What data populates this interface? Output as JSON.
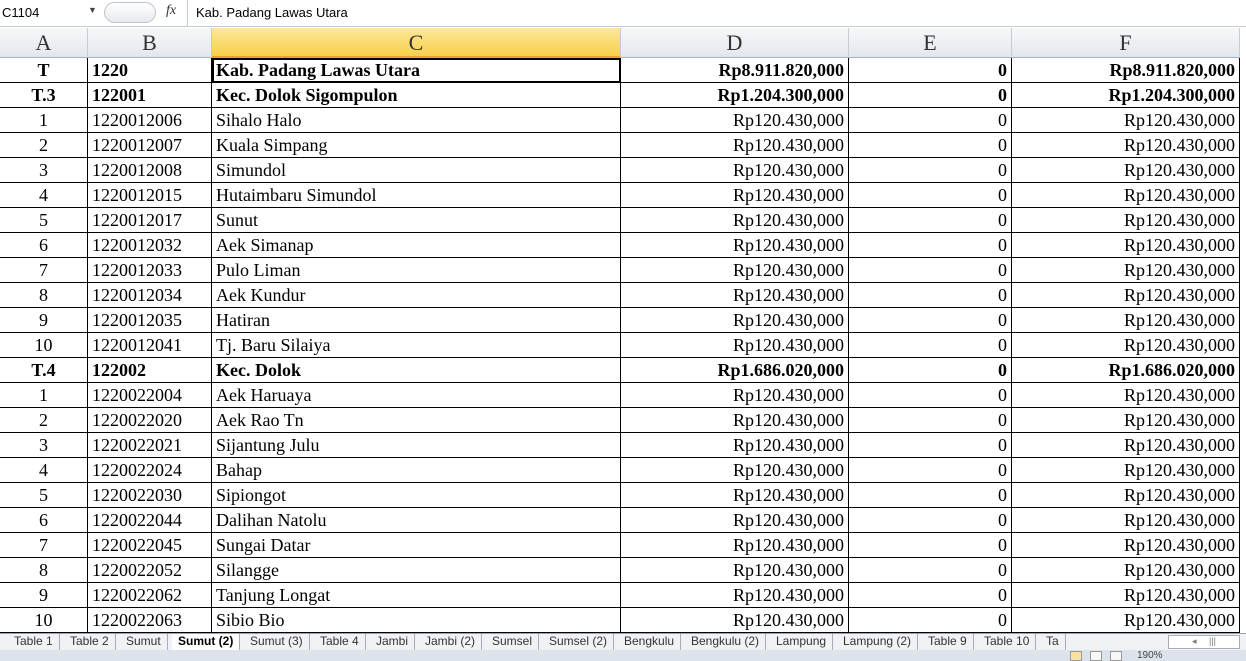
{
  "formula_bar": {
    "name_box": "C1104",
    "fx_label": "fx",
    "content": "Kab.  Padang  Lawas  Utara"
  },
  "columns": [
    "A",
    "B",
    "C",
    "D",
    "E",
    "F"
  ],
  "selected_column": "C",
  "rows": [
    {
      "a": "T",
      "b": "1220",
      "c": "Kab.  Padang  Lawas  Utara",
      "d": "Rp8.911.820,000",
      "e": "0",
      "f": "Rp8.911.820,000",
      "bold": true
    },
    {
      "a": "T.3",
      "b": "122001",
      "c": "Kec.  Dolok  Sigompulon",
      "d": "Rp1.204.300,000",
      "e": "0",
      "f": "Rp1.204.300,000",
      "bold": true
    },
    {
      "a": "1",
      "b": "1220012006",
      "c": "Sihalo  Halo",
      "d": "Rp120.430,000",
      "e": "0",
      "f": "Rp120.430,000"
    },
    {
      "a": "2",
      "b": "1220012007",
      "c": "Kuala  Simpang",
      "d": "Rp120.430,000",
      "e": "0",
      "f": "Rp120.430,000"
    },
    {
      "a": "3",
      "b": "1220012008",
      "c": "Simundol",
      "d": "Rp120.430,000",
      "e": "0",
      "f": "Rp120.430,000"
    },
    {
      "a": "4",
      "b": "1220012015",
      "c": "Hutaimbaru  Simundol",
      "d": "Rp120.430,000",
      "e": "0",
      "f": "Rp120.430,000"
    },
    {
      "a": "5",
      "b": "1220012017",
      "c": "Sunut",
      "d": "Rp120.430,000",
      "e": "0",
      "f": "Rp120.430,000"
    },
    {
      "a": "6",
      "b": "1220012032",
      "c": "Aek  Simanap",
      "d": "Rp120.430,000",
      "e": "0",
      "f": "Rp120.430,000"
    },
    {
      "a": "7",
      "b": "1220012033",
      "c": "Pulo  Liman",
      "d": "Rp120.430,000",
      "e": "0",
      "f": "Rp120.430,000"
    },
    {
      "a": "8",
      "b": "1220012034",
      "c": "Aek  Kundur",
      "d": "Rp120.430,000",
      "e": "0",
      "f": "Rp120.430,000"
    },
    {
      "a": "9",
      "b": "1220012035",
      "c": "Hatiran",
      "d": "Rp120.430,000",
      "e": "0",
      "f": "Rp120.430,000"
    },
    {
      "a": "10",
      "b": "1220012041",
      "c": "Tj.  Baru  Silaiya",
      "d": "Rp120.430,000",
      "e": "0",
      "f": "Rp120.430,000"
    },
    {
      "a": "T.4",
      "b": "122002",
      "c": "Kec.  Dolok",
      "d": "Rp1.686.020,000",
      "e": "0",
      "f": "Rp1.686.020,000",
      "bold": true
    },
    {
      "a": "1",
      "b": "1220022004",
      "c": "Aek Haruaya",
      "d": "Rp120.430,000",
      "e": "0",
      "f": "Rp120.430,000"
    },
    {
      "a": "2",
      "b": "1220022020",
      "c": "Aek Rao Tn",
      "d": "Rp120.430,000",
      "e": "0",
      "f": "Rp120.430,000"
    },
    {
      "a": "3",
      "b": "1220022021",
      "c": "Sijantung  Julu",
      "d": "Rp120.430,000",
      "e": "0",
      "f": "Rp120.430,000"
    },
    {
      "a": "4",
      "b": "1220022024",
      "c": "Bahap",
      "d": "Rp120.430,000",
      "e": "0",
      "f": "Rp120.430,000"
    },
    {
      "a": "5",
      "b": "1220022030",
      "c": "Sipiongot",
      "d": "Rp120.430,000",
      "e": "0",
      "f": "Rp120.430,000"
    },
    {
      "a": "6",
      "b": "1220022044",
      "c": "Dalihan  Natolu",
      "d": "Rp120.430,000",
      "e": "0",
      "f": "Rp120.430,000"
    },
    {
      "a": "7",
      "b": "1220022045",
      "c": "Sungai  Datar",
      "d": "Rp120.430,000",
      "e": "0",
      "f": "Rp120.430,000"
    },
    {
      "a": "8",
      "b": "1220022052",
      "c": "Silangge",
      "d": "Rp120.430,000",
      "e": "0",
      "f": "Rp120.430,000"
    },
    {
      "a": "9",
      "b": "1220022062",
      "c": "Tanjung  Longat",
      "d": "Rp120.430,000",
      "e": "0",
      "f": "Rp120.430,000"
    },
    {
      "a": "10",
      "b": "1220022063",
      "c": "Sibio Bio",
      "d": "Rp120.430,000",
      "e": "0",
      "f": "Rp120.430,000"
    }
  ],
  "sheet_tabs": [
    "Table 1",
    "Table 2",
    "Sumut",
    "Sumut (2)",
    "Sumut (3)",
    "Table 4",
    "Jambi",
    "Jambi (2)",
    "Sumsel",
    "Sumsel (2)",
    "Bengkulu",
    "Bengkulu (2)",
    "Lampung",
    "Lampung (2)",
    "Table 9",
    "Table 10",
    "Ta"
  ],
  "active_tab": "Sumut (2)",
  "status": {
    "zoom": "190%"
  }
}
